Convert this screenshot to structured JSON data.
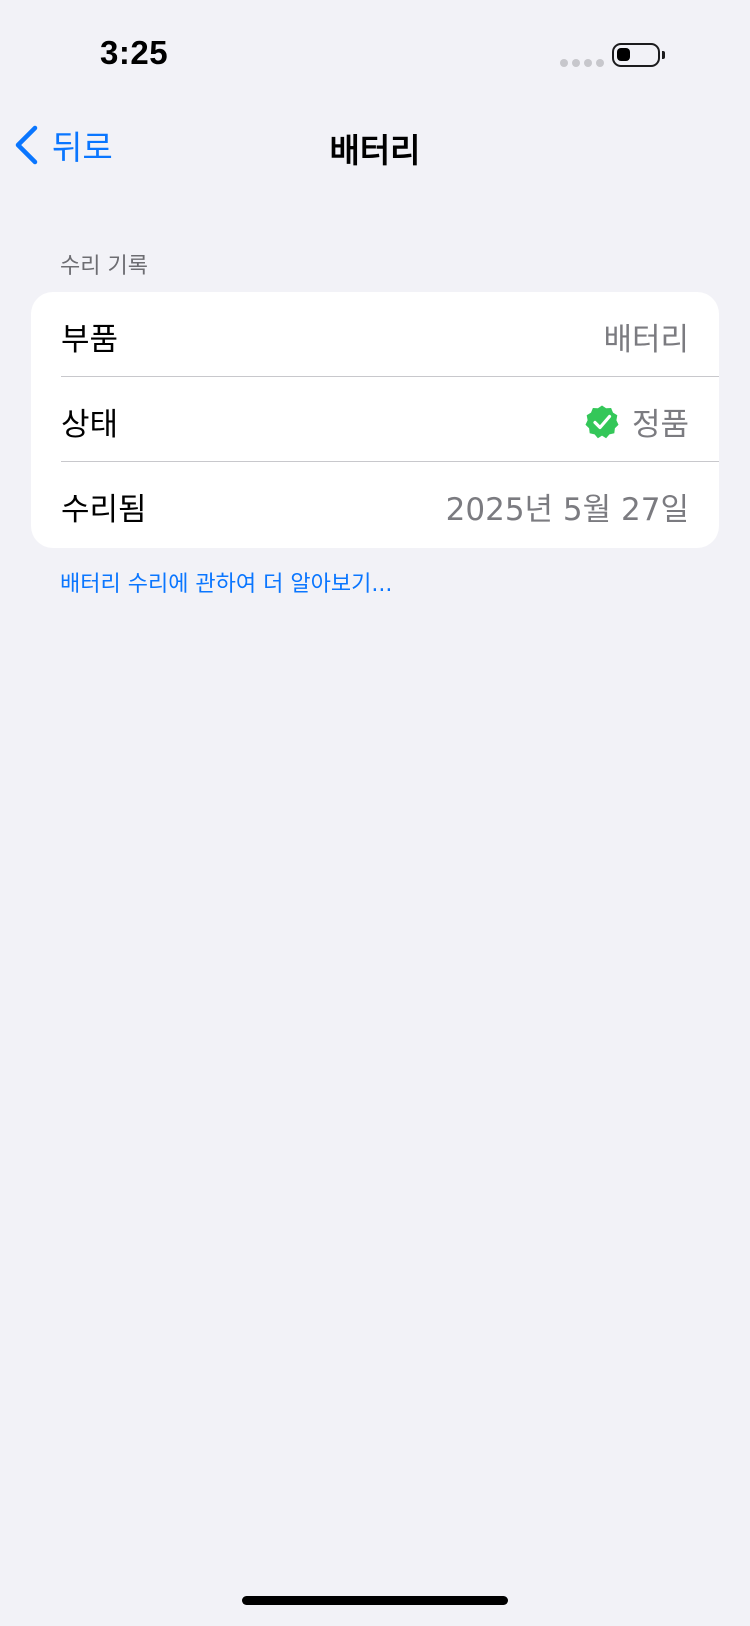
{
  "status_bar": {
    "time": "3:25"
  },
  "nav": {
    "back_label": "뒤로",
    "title": "배터리"
  },
  "section": {
    "header": "수리 기록",
    "rows": [
      {
        "label": "부품",
        "value": "배터리"
      },
      {
        "label": "상태",
        "value": "정품",
        "icon": "verified-checkmark-icon",
        "icon_color": "#34c759"
      },
      {
        "label": "수리됨",
        "value": "2025년 5월 27일"
      }
    ]
  },
  "footer_link": "배터리 수리에 관하여 더 알아보기...",
  "colors": {
    "accent": "#0a76ff",
    "background": "#f2f2f7",
    "secondary_text": "#7b7b80",
    "verified": "#34c759"
  }
}
